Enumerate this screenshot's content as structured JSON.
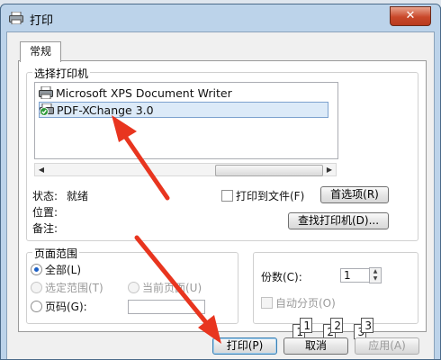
{
  "window": {
    "title": "打印",
    "close_glyph": "✕"
  },
  "tabs": [
    {
      "label": "常规"
    }
  ],
  "select_printer": {
    "group_label": "选择打印机",
    "printers": [
      {
        "name": "Microsoft XPS Document Writer"
      },
      {
        "name": "PDF-XChange 3.0",
        "selected": true
      }
    ]
  },
  "status": {
    "status_label": "状态:",
    "status_value": "就绪",
    "location_label": "位置:",
    "comment_label": "备注:"
  },
  "print_to_file_label": "打印到文件(F)",
  "preferences_button": "首选项(R)",
  "find_printer_button": "查找打印机(D)...",
  "page_range": {
    "group_label": "页面范围",
    "all": "全部(L)",
    "selection": "选定范围(T)",
    "current_page": "当前页面(U)",
    "pages": "页码(G):"
  },
  "copies": {
    "label": "份数(C):",
    "value": "1",
    "collate_label": "自动分页(O)",
    "collate_pages": [
      "1",
      "1",
      "2",
      "2",
      "3",
      "3"
    ]
  },
  "buttons": {
    "print": "打印(P)",
    "cancel": "取消",
    "apply": "应用(A)"
  },
  "colors": {
    "annotation_arrow": "#e8351f",
    "selection_bg": "#dceaf8"
  }
}
